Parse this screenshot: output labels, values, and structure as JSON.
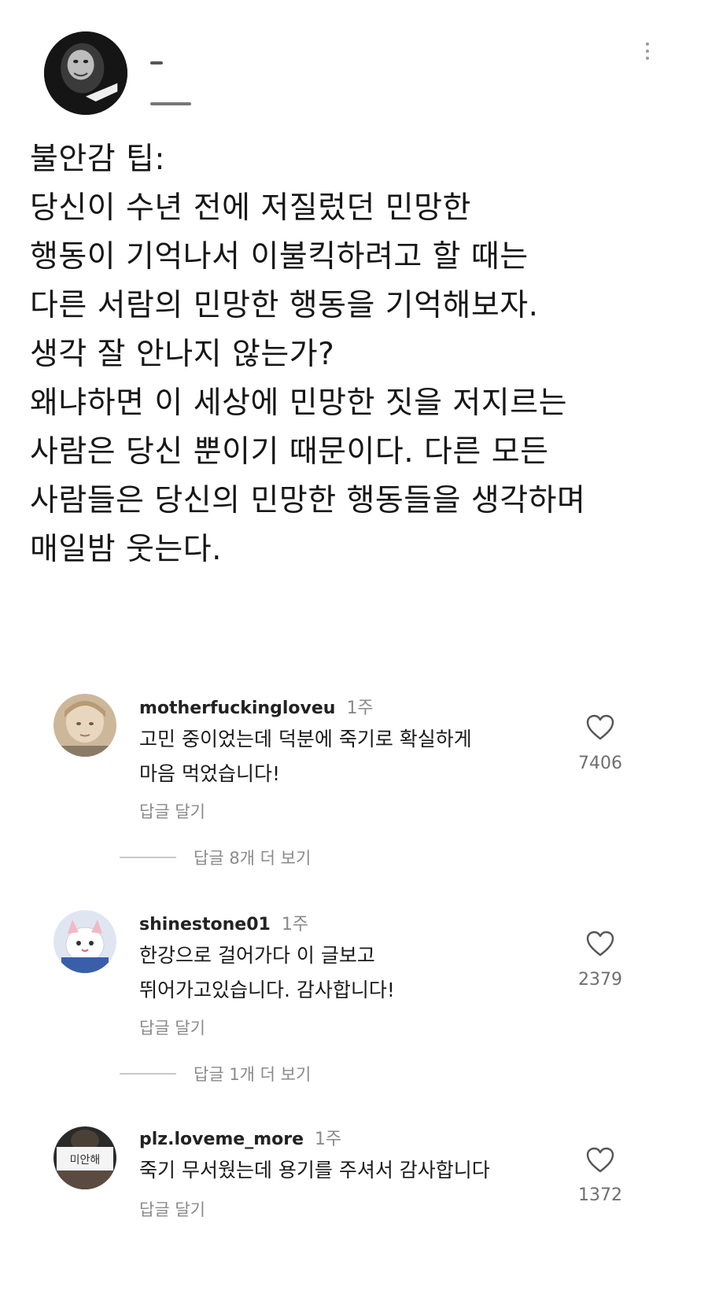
{
  "post": {
    "more_icon": "more-vertical-icon",
    "text": "불안감 팁:\n당신이 수년 전에 저질렀던 민망한\n행동이 기억나서 이불킥하려고 할 때는\n다른 서람의 민망한 행동을 기억해보자.\n생각 잘 안나지 않는가?\n왜냐하면 이 세상에 민망한 짓을 저지르는\n사람은 당신 뿐이기 때문이다. 다른 모든\n사람들은 당신의 민망한 행동들을 생각하며\n매일밤 웃는다."
  },
  "comments": [
    {
      "username": "motherfuckingloveu",
      "time": "1주",
      "text": "고민 중이었는데 덕분에 죽기로 확실하게\n마음 먹었습니다!",
      "reply_label": "답글 달기",
      "likes": "7406",
      "view_replies": "답글 8개 더 보기"
    },
    {
      "username": "shinestone01",
      "time": "1주",
      "text": "한강으로 걸어가다 이 글보고\n뛰어가고있습니다. 감사합니다!",
      "reply_label": "답글 달기",
      "likes": "2379",
      "view_replies": "답글 1개 더 보기"
    },
    {
      "username": "plz.loveme_more",
      "time": "1주",
      "text": "죽기 무서웠는데 용기를 주셔서 감사합니다",
      "reply_label": "답글 달기",
      "likes": "1372",
      "avatar_sign_text": "미안해"
    }
  ],
  "icons": {
    "heart": "heart-outline-icon"
  }
}
